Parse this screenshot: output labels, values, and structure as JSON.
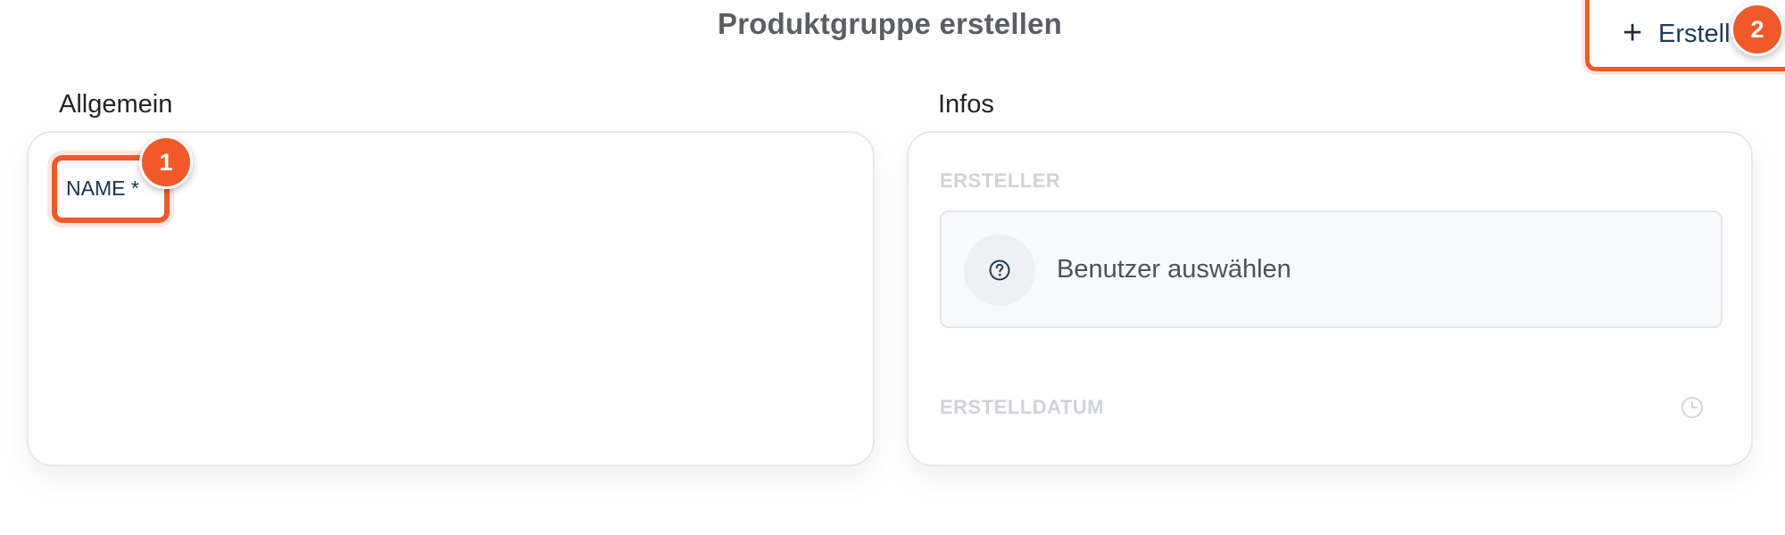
{
  "header": {
    "title": "Produktgruppe erstellen",
    "create_button_label": "Erstelle",
    "create_button_icon": "plus-icon"
  },
  "annotations": {
    "badge_1": "1",
    "badge_2": "2",
    "highlight_color": "#f05a2b"
  },
  "sections": {
    "general": {
      "title": "Allgemein",
      "name_label": "NAME *"
    },
    "infos": {
      "title": "Infos",
      "creator_label": "ERSTELLER",
      "creator_placeholder": "Benutzer auswählen",
      "creator_icon": "question-circle-icon",
      "date_label": "ERSTELLDATUM",
      "date_icon": "clock-icon"
    }
  }
}
